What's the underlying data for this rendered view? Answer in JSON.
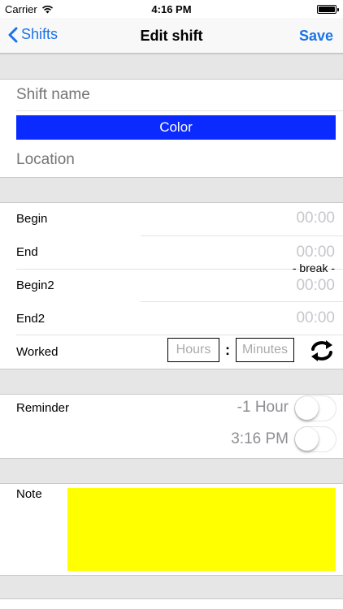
{
  "status_bar": {
    "carrier": "Carrier",
    "time": "4:16 PM"
  },
  "nav": {
    "back_label": "Shifts",
    "title": "Edit shift",
    "save_label": "Save"
  },
  "shift": {
    "name_placeholder": "Shift name",
    "color_label": "Color",
    "color_value": "#0a2aff",
    "location_placeholder": "Location"
  },
  "times": {
    "begin_label": "Begin",
    "begin_value": "00:00",
    "end_label": "End",
    "end_value": "00:00",
    "break_label": "- break -",
    "begin2_label": "Begin2",
    "begin2_value": "00:00",
    "end2_label": "End2",
    "end2_value": "00:00",
    "worked_label": "Worked",
    "hours_placeholder": "Hours",
    "colon": ":",
    "minutes_placeholder": "Minutes"
  },
  "reminder": {
    "label": "Reminder",
    "offset_value": "-1 Hour",
    "time_value": "3:16 PM"
  },
  "note": {
    "label": "Note",
    "color": "#ffff00"
  },
  "colors": {
    "accent": "#1a73e8",
    "separator": "#e6e6e6"
  },
  "icons": {
    "back": "chevron-left-icon",
    "wifi": "wifi-icon",
    "battery": "battery-icon",
    "refresh": "refresh-icon"
  }
}
